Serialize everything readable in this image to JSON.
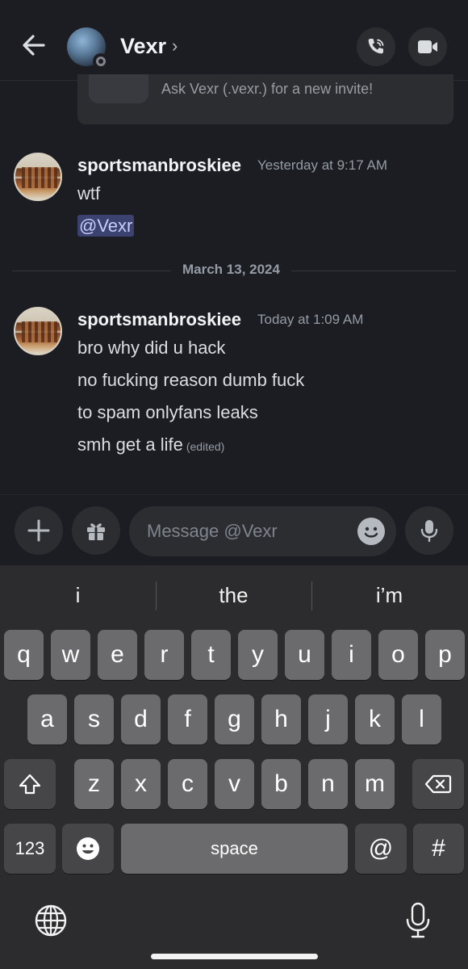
{
  "header": {
    "contact_name": "Vexr",
    "chevron": "›",
    "back_icon": "arrow-left-icon",
    "call_icon": "phone-icon",
    "video_icon": "video-camera-icon"
  },
  "invite_card": {
    "text": "Ask Vexr (.vexr.) for a new invite!"
  },
  "messages": [
    {
      "author": "sportsmanbroskiee",
      "timestamp": "Yesterday at 9:17 AM",
      "lines": [
        "wtf"
      ],
      "mention": "@Vexr"
    },
    {
      "author": "sportsmanbroskiee",
      "timestamp": "Today at 1:09 AM",
      "lines": [
        "bro why did u hack",
        "no fucking reason dumb fuck",
        "to spam onlyfans leaks",
        "smh get a life"
      ],
      "edited_label": "(edited)"
    }
  ],
  "date_divider": "March 13, 2024",
  "composer": {
    "placeholder": "Message @Vexr",
    "value": ""
  },
  "keyboard": {
    "suggestions": [
      "i",
      "the",
      "i’m"
    ],
    "row1": [
      "q",
      "w",
      "e",
      "r",
      "t",
      "y",
      "u",
      "i",
      "o",
      "p"
    ],
    "row2": [
      "a",
      "s",
      "d",
      "f",
      "g",
      "h",
      "j",
      "k",
      "l"
    ],
    "row3": [
      "z",
      "x",
      "c",
      "v",
      "b",
      "n",
      "m"
    ],
    "numbers_label": "123",
    "space_label": "space",
    "at_label": "@",
    "hash_label": "#"
  },
  "colors": {
    "background": "#1c1d22",
    "mention_bg": "#3c4270",
    "keyboard_bg": "#2c2c2e"
  }
}
